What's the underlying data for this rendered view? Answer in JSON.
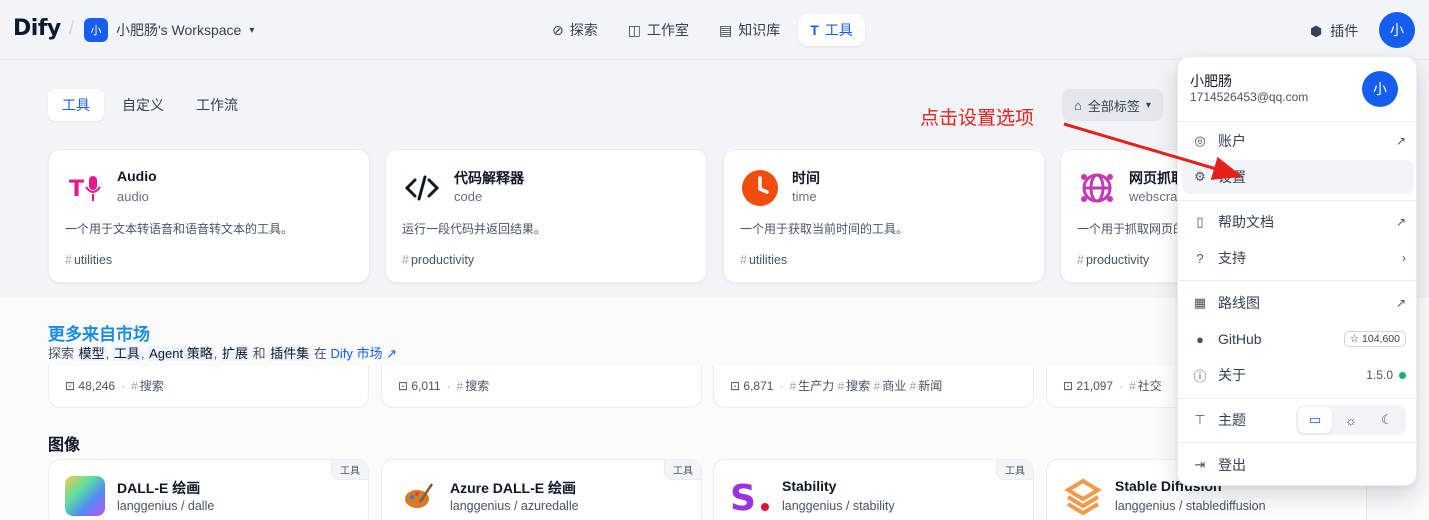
{
  "header": {
    "logo_text_a": "Di",
    "logo_text_b": "fy",
    "workspace_avatar": "小",
    "workspace_name": "小肥肠's Workspace",
    "nav": [
      {
        "label": "探索",
        "icon": "explore-icon"
      },
      {
        "label": "工作室",
        "icon": "robot-icon"
      },
      {
        "label": "知识库",
        "icon": "book-icon"
      },
      {
        "label": "工具",
        "icon": "tool-icon"
      }
    ],
    "active_nav": "工具",
    "plugins_label": "插件",
    "user_avatar": "小"
  },
  "tabs": [
    "工具",
    "自定义",
    "工作流"
  ],
  "active_tab": "工具",
  "tag_filter_label": "全部标签",
  "tool_cards": [
    {
      "title": "Audio",
      "sub": "audio",
      "desc": "一个用于文本转语音和语音转文本的工具。",
      "tag": "utilities",
      "icon": "audio-icon"
    },
    {
      "title": "代码解释器",
      "sub": "code",
      "desc": "运行一段代码并返回结果。",
      "tag": "productivity",
      "icon": "code-icon"
    },
    {
      "title": "时间",
      "sub": "time",
      "desc": "一个用于获取当前时间的工具。",
      "tag": "utilities",
      "icon": "clock-icon"
    },
    {
      "title": "网页抓取",
      "sub": "webscraper",
      "desc": "一个用于抓取网页的工具。",
      "tag": "productivity",
      "icon": "globe-icon"
    }
  ],
  "marketplace": {
    "title": "更多来自市场",
    "sub_prefix": "探索",
    "sub_items": [
      "模型",
      "工具",
      "Agent 策略",
      "扩展",
      "插件集"
    ],
    "sub_in": "在",
    "link": "Dify 市场 ↗",
    "cards": [
      {
        "installs": "48,246",
        "tags": [
          "搜索"
        ]
      },
      {
        "installs": "6,011",
        "tags": [
          "搜索"
        ]
      },
      {
        "installs": "6,871",
        "tags": [
          "生产力",
          "搜索",
          "商业",
          "新闻"
        ]
      },
      {
        "installs": "21,097",
        "tags": [
          "社交"
        ]
      }
    ]
  },
  "image_section": {
    "title": "图像",
    "badge": "工具",
    "cards": [
      {
        "title": "DALL-E 绘画",
        "sub": "langgenius / dalle"
      },
      {
        "title": "Azure DALL-E 绘画",
        "sub": "langgenius / azuredalle"
      },
      {
        "title": "Stability",
        "sub": "langgenius / stability"
      },
      {
        "title": "Stable Diffusion",
        "sub": "langgenius / stablediffusion"
      }
    ]
  },
  "menu": {
    "name": "小肥肠",
    "email": "1714526453@qq.com",
    "avatar": "小",
    "items": {
      "account": "账户",
      "settings": "设置",
      "help": "帮助文档",
      "support": "支持",
      "roadmap": "路线图",
      "github": "GitHub",
      "github_stars": "☆ 104,600",
      "about": "关于",
      "version": "1.5.0",
      "theme": "主题",
      "logout": "登出"
    }
  },
  "annotation": "点击设置选项",
  "colors": {
    "accent": "#155eef",
    "annotation": "#e8201b",
    "market_title": "#1a8ce8"
  }
}
